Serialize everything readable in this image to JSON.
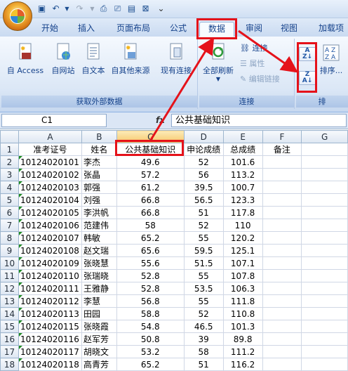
{
  "qat": {
    "menu_glyph": "⌄"
  },
  "tabs": [
    "开始",
    "插入",
    "页面布局",
    "公式",
    "数据",
    "审阅",
    "视图",
    "加载项"
  ],
  "ribbon": {
    "get_external": {
      "caption": "获取外部数据",
      "items": [
        "自 Access",
        "自网站",
        "自文本",
        "自其他来源",
        "现有连接"
      ]
    },
    "connections": {
      "caption": "连接",
      "refresh_label": "全部刷新",
      "connections_label": "连接",
      "properties_label": "属性",
      "edit_links_label": "编辑链接"
    },
    "sort": {
      "sort_label": "排序...",
      "caption": "排"
    }
  },
  "formula_bar": {
    "name_box": "C1",
    "fx": "fx",
    "content": "公共基础知识"
  },
  "columns": [
    "",
    "A",
    "B",
    "C",
    "D",
    "E",
    "F",
    "G"
  ],
  "headers": [
    "准考证号",
    "姓名",
    "公共基础知识",
    "申论成绩",
    "总成绩",
    "备注"
  ],
  "rows": [
    [
      "10124020101",
      "李杰",
      "49.6",
      "52",
      "101.6"
    ],
    [
      "10124020102",
      "张晶",
      "57.2",
      "56",
      "113.2"
    ],
    [
      "10124020103",
      "郭强",
      "61.2",
      "39.5",
      "100.7"
    ],
    [
      "10124020104",
      "刘强",
      "66.8",
      "56.5",
      "123.3"
    ],
    [
      "10124020105",
      "李洪帆",
      "66.8",
      "51",
      "117.8"
    ],
    [
      "10124020106",
      "范建伟",
      "58",
      "52",
      "110"
    ],
    [
      "10124020107",
      "韩敏",
      "65.2",
      "55",
      "120.2"
    ],
    [
      "10124020108",
      "赵文瑞",
      "65.6",
      "59.5",
      "125.1"
    ],
    [
      "10124020109",
      "张晓慧",
      "55.6",
      "51.5",
      "107.1"
    ],
    [
      "10124020110",
      "张瑞晓",
      "52.8",
      "55",
      "107.8"
    ],
    [
      "10124020111",
      "王雅静",
      "52.8",
      "53.5",
      "106.3"
    ],
    [
      "10124020112",
      "李慧",
      "56.8",
      "55",
      "111.8"
    ],
    [
      "10124020113",
      "田园",
      "58.8",
      "52",
      "110.8"
    ],
    [
      "10124020115",
      "张晓霞",
      "54.8",
      "46.5",
      "101.3"
    ],
    [
      "10124020116",
      "赵军芳",
      "50.8",
      "39",
      "89.8"
    ],
    [
      "10124020117",
      "胡晓文",
      "53.2",
      "58",
      "111.2"
    ],
    [
      "10124020118",
      "高青芳",
      "65.2",
      "51",
      "116.2"
    ]
  ],
  "colors": {
    "annotation": "#e5121a",
    "accent": "#15428b"
  }
}
